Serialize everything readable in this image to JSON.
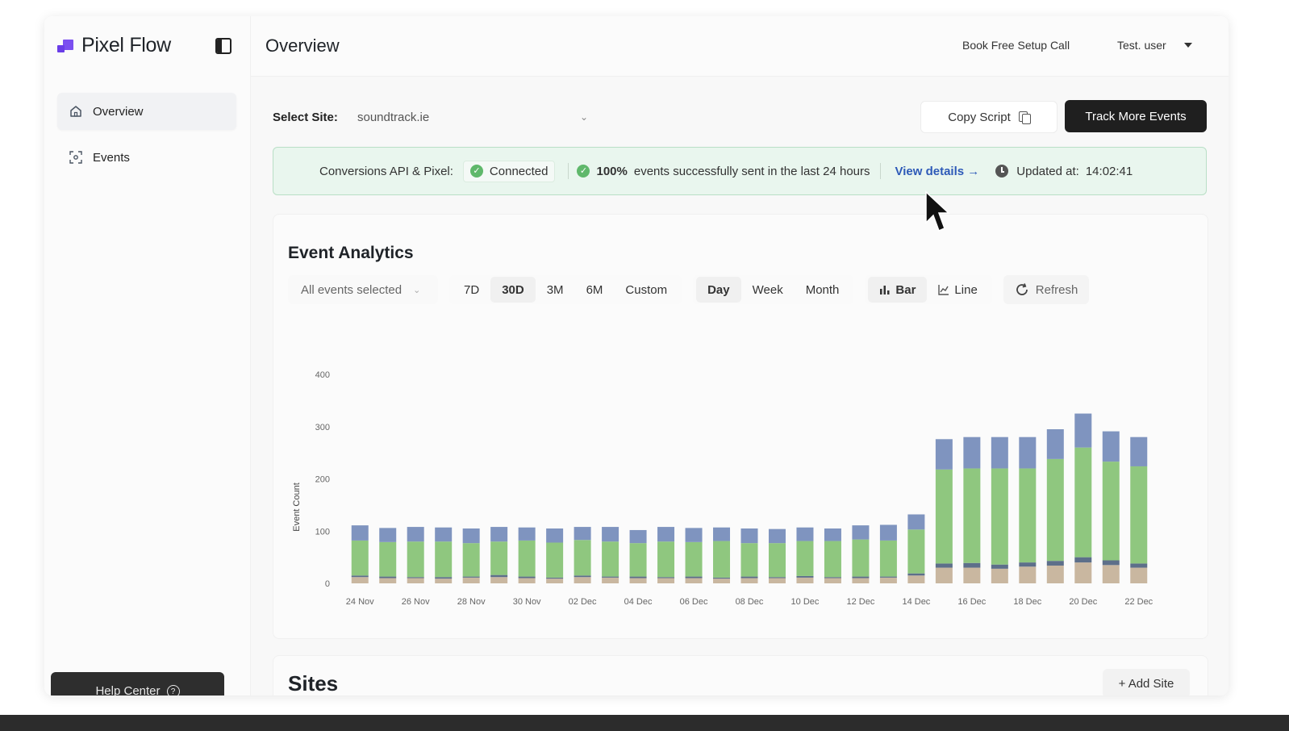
{
  "app": {
    "brand_name": "Pixel Flow",
    "brand_color": "#6a3de8"
  },
  "sidebar": {
    "items": [
      {
        "label": "Overview",
        "icon": "home-icon",
        "active": true
      },
      {
        "label": "Events",
        "icon": "events-icon",
        "active": false
      }
    ],
    "help_label": "Help Center",
    "help_icon": "question-icon"
  },
  "header": {
    "title": "Overview",
    "book_call": "Book Free Setup Call",
    "user": "Test. user"
  },
  "site_bar": {
    "label": "Select Site:",
    "selected_site": "soundtrack.ie",
    "copy_label": "Copy Script",
    "track_label": "Track More Events"
  },
  "status": {
    "label": "Conversions API & Pixel:",
    "connection": "Connected",
    "percent": "100%",
    "message": "events successfully sent in the last 24 hours",
    "link": "View details →",
    "updated_label": "Updated at:",
    "updated_time": "14:02:41",
    "success_color": "#5fb86b"
  },
  "analytics": {
    "title": "Event Analytics",
    "events_select": "All events selected",
    "ranges": [
      {
        "label": "7D",
        "selected": false
      },
      {
        "label": "30D",
        "selected": true
      },
      {
        "label": "3M",
        "selected": false
      },
      {
        "label": "6M",
        "selected": false
      },
      {
        "label": "Custom",
        "selected": false
      }
    ],
    "granularity": [
      {
        "label": "Day",
        "selected": true
      },
      {
        "label": "Week",
        "selected": false
      },
      {
        "label": "Month",
        "selected": false
      }
    ],
    "chart_types": [
      {
        "label": "Bar",
        "icon": "bar-chart-icon",
        "selected": true
      },
      {
        "label": "Line",
        "icon": "line-chart-icon",
        "selected": false
      }
    ],
    "refresh_label": "Refresh"
  },
  "chart_data": {
    "type": "bar",
    "stacked": true,
    "ylabel": "Event Count",
    "ylim": [
      0,
      400
    ],
    "yticks": [
      0,
      100,
      200,
      300,
      400
    ],
    "categories": [
      "24 Nov",
      "25 Nov",
      "26 Nov",
      "27 Nov",
      "28 Nov",
      "29 Nov",
      "30 Nov",
      "01 Dec",
      "02 Dec",
      "03 Dec",
      "04 Dec",
      "05 Dec",
      "06 Dec",
      "07 Dec",
      "08 Dec",
      "09 Dec",
      "10 Dec",
      "11 Dec",
      "12 Dec",
      "13 Dec",
      "14 Dec",
      "15 Dec",
      "16 Dec",
      "17 Dec",
      "18 Dec",
      "19 Dec",
      "20 Dec",
      "21 Dec",
      "22 Dec"
    ],
    "tick_labels": [
      "24 Nov",
      "26 Nov",
      "28 Nov",
      "30 Nov",
      "02 Dec",
      "04 Dec",
      "06 Dec",
      "08 Dec",
      "10 Dec",
      "12 Dec",
      "14 Dec",
      "16 Dec",
      "18 Dec",
      "20 Dec",
      "22 Dec"
    ],
    "series": [
      {
        "color": "#c9b7a0",
        "values": [
          12,
          10,
          10,
          9,
          11,
          12,
          10,
          9,
          12,
          11,
          10,
          10,
          10,
          9,
          10,
          10,
          11,
          10,
          10,
          11,
          15,
          30,
          30,
          28,
          32,
          34,
          40,
          35,
          30
        ]
      },
      {
        "color": "#5d6f8a",
        "values": [
          3,
          3,
          2,
          3,
          2,
          4,
          3,
          2,
          3,
          2,
          3,
          2,
          3,
          2,
          3,
          2,
          3,
          2,
          3,
          2,
          4,
          8,
          9,
          8,
          8,
          9,
          10,
          9,
          8
        ]
      },
      {
        "color": "#8fc77f",
        "values": [
          67,
          66,
          68,
          68,
          64,
          64,
          69,
          67,
          68,
          67,
          64,
          68,
          66,
          70,
          64,
          65,
          67,
          69,
          71,
          69,
          84,
          180,
          181,
          184,
          180,
          195,
          210,
          189,
          186
        ]
      },
      {
        "color": "#7f94bf",
        "values": [
          29,
          27,
          28,
          27,
          28,
          28,
          25,
          27,
          25,
          28,
          25,
          28,
          27,
          26,
          28,
          27,
          26,
          24,
          27,
          30,
          29,
          58,
          60,
          60,
          60,
          57,
          65,
          58,
          56
        ]
      }
    ]
  },
  "sites": {
    "title": "Sites",
    "add_label": "+ Add Site"
  }
}
